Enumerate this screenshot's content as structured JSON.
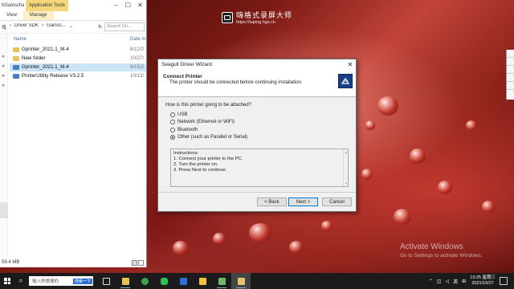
{
  "desktop": {
    "watermark_title": "嗨格式录屏大师",
    "watermark_url": "https://luping.hgs.cn",
    "activate_line1": "Activate Windows",
    "activate_line2": "Go to Settings to activate Windows."
  },
  "explorer": {
    "app_name": "hGainscha...",
    "context_tab": "Application Tools",
    "ribbon_tabs": [
      "View",
      "Manage"
    ],
    "address": {
      "left_text": "戏",
      "crumbs": [
        "Driver SDK",
        "Gainsc..."
      ],
      "search_placeholder": "Search Dri..."
    },
    "columns": {
      "name": "Name",
      "date": "Date m"
    },
    "files": [
      {
        "name": "Gprinter_2021.1_M-4",
        "date": "8/12/2",
        "type": "folder"
      },
      {
        "name": "New folder",
        "date": "10/27/",
        "type": "folder"
      },
      {
        "name": "Gprinter_2021.1_M-4",
        "date": "6/15/2",
        "type": "app"
      },
      {
        "name": "PrinterUtility Release V3.2.5",
        "date": "10/13/",
        "type": "app"
      }
    ],
    "status": "59.4 MB"
  },
  "wizard": {
    "title": "Seagull Driver Wizard",
    "header_title": "Connect Printer",
    "header_subtitle": "The printer should be connected before continuing installation.",
    "question": "How is this printer going to be attached?",
    "options": [
      {
        "label": "USB",
        "selected": false
      },
      {
        "label": "Network (Ethernet or WiFi)",
        "selected": false
      },
      {
        "label": "Bluetooth",
        "selected": false
      },
      {
        "label": "Other (such as Parallel or Serial)",
        "selected": true
      }
    ],
    "instructions": [
      "Instructions:",
      "1. Connect your printer to the PC.",
      "2. Turn the printer on.",
      "3. Press Next to continue."
    ],
    "buttons": {
      "back": "< Back",
      "next": "Next >",
      "cancel": "Cancel"
    }
  },
  "taskbar": {
    "search_placeholder": "输入你想搜的",
    "search_tag": "搜索一下",
    "apps": [
      "file-explorer",
      "browser",
      "wechat",
      "video-app",
      "folder",
      "printer-app",
      "wizard-app"
    ],
    "tray_ime": "英",
    "time": "13:25 星期三",
    "date": "2021/10/27"
  },
  "colors": {
    "accent": "#0078d7",
    "taskbar": "#1b1b1b",
    "wizard_logo": "#1c3f8c"
  }
}
